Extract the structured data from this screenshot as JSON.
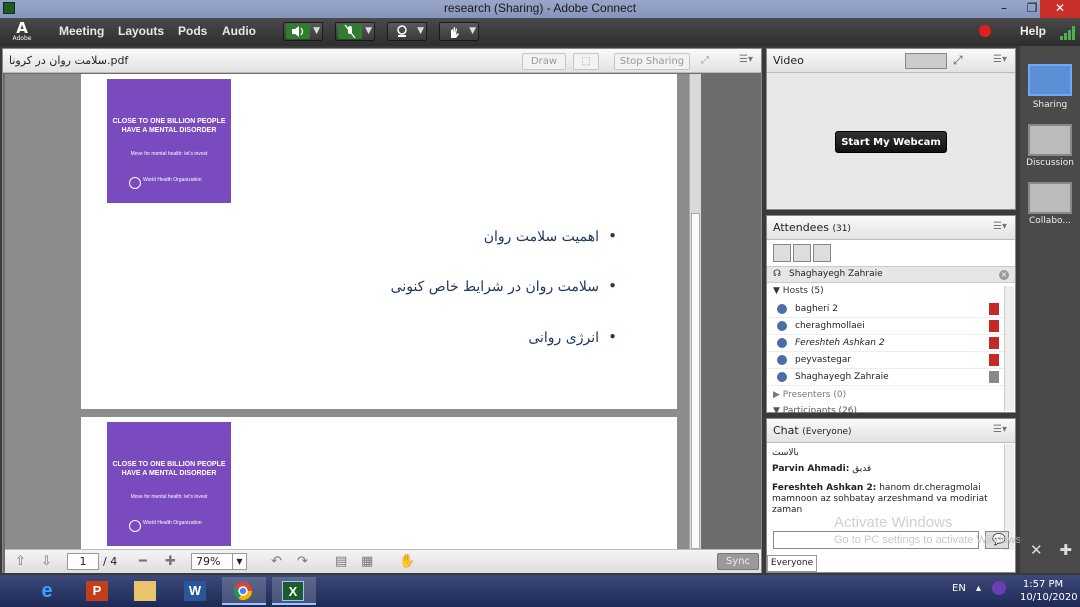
{
  "window": {
    "title": "research (Sharing) - Adobe Connect",
    "minimize": "–",
    "restore": "❐",
    "close": "✕"
  },
  "menubar": {
    "logo_text": "Adobe",
    "items": [
      "Meeting",
      "Layouts",
      "Pods",
      "Audio"
    ],
    "help": "Help"
  },
  "share_pod": {
    "filename": "سلامت روان در کرونا.pdf",
    "draw_label": "Draw",
    "stop_sharing_label": "Stop Sharing",
    "slide": {
      "poster_headline": "CLOSE TO ONE BILLION PEOPLE HAVE A MENTAL DISORDER",
      "poster_tagline": "Move for mental health: let's invest",
      "poster_org": "World Health Organization",
      "bullets": [
        "اهمیت سلامت روان",
        "سلامت روان در شرایط خاص کنونی",
        "انرژی روانی"
      ]
    },
    "toolbar": {
      "page_current": "1",
      "page_total": "/ 4",
      "zoom": "79%",
      "sync_label": "Sync"
    }
  },
  "video_pod": {
    "title": "Video",
    "start_webcam_label": "Start My Webcam"
  },
  "attendees_pod": {
    "title": "Attendees",
    "count": "(31)",
    "current_user": "Shaghayegh Zahraie",
    "hosts_label": "Hosts (5)",
    "hosts": [
      "bagheri 2",
      "cheraghmollaei",
      "Fereshteh Ashkan 2",
      "peyvastegar",
      "Shaghayegh Zahraie"
    ],
    "presenters_label": "Presenters (0)",
    "participants_label": "Participants (26)"
  },
  "chat_pod": {
    "title": "Chat",
    "scope": "(Everyone)",
    "messages": [
      {
        "author": "",
        "text": "بالاست"
      },
      {
        "author": "Parvin Ahmadi:",
        "text": "قدیق"
      },
      {
        "author": "Fereshteh Ashkan 2:",
        "text": "hanom dr.cheragmolai mamnoon az sohbatay arzeshmand va modiriat zaman"
      }
    ],
    "tab_label": "Everyone"
  },
  "watermark": {
    "line1": "Activate Windows",
    "line2": "Go to PC settings to activate Windows."
  },
  "layouts_rail": {
    "items": [
      "Sharing",
      "Discussion",
      "Collabo..."
    ]
  },
  "taskbar": {
    "apps": [
      "e",
      "P",
      "",
      "W",
      "",
      "X"
    ],
    "lang": "EN",
    "time": "1:57 PM",
    "date": "10/10/2020"
  },
  "colors": {
    "accent": "#5b8fd1",
    "record": "#e02020",
    "poster": "#7a4bbf",
    "bullet_text": "#1f3864"
  }
}
